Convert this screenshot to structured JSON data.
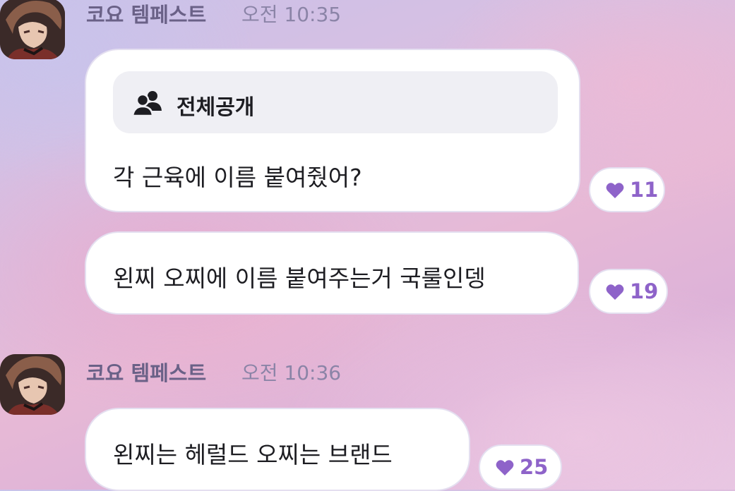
{
  "theme": {
    "accent": "#8e63c9",
    "bubble_bg": "#ffffff",
    "sender_color": "#6a6187"
  },
  "groups": [
    {
      "sender": "코요 템페스트",
      "time": "오전 10:35",
      "messages": [
        {
          "visibility": {
            "icon": "users-icon",
            "label": "전체공개"
          },
          "text": "각 근육에 이름 붙여줬어?",
          "likes": "11"
        },
        {
          "text": "왼찌 오찌에 이름 붙여주는거 국룰인뎅",
          "likes": "19"
        }
      ]
    },
    {
      "sender": "코요 템페스트",
      "time": "오전 10:36",
      "messages": [
        {
          "text": "왼찌는 헤럴드 오찌는 브랜드",
          "likes": "25"
        }
      ]
    }
  ]
}
